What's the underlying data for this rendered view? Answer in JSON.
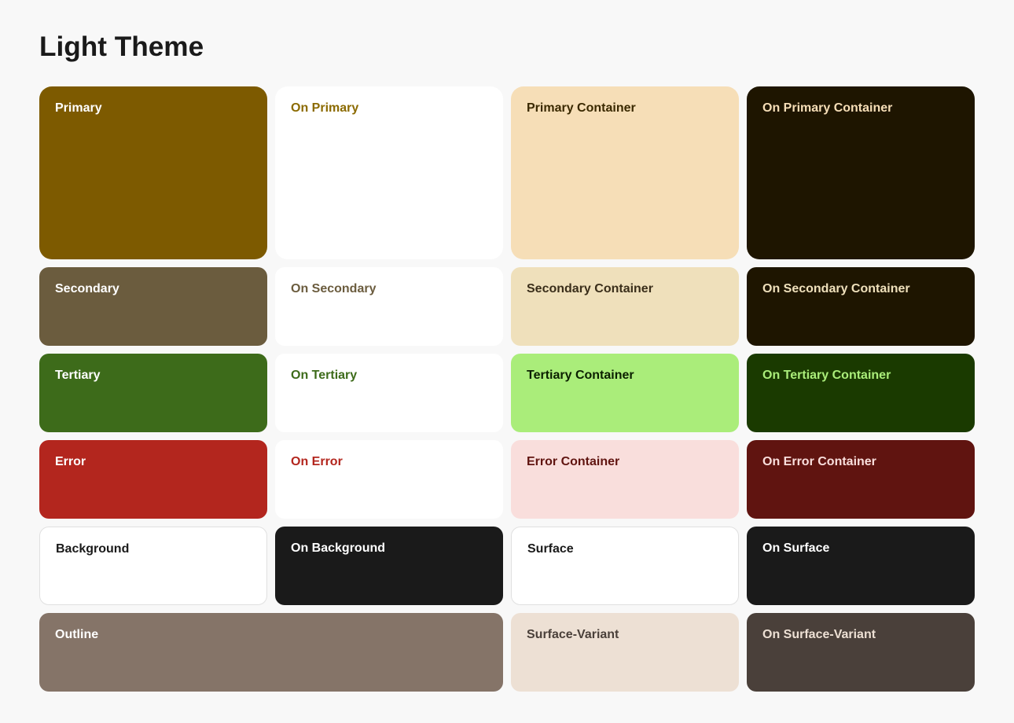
{
  "title": "Light Theme",
  "colors": {
    "primary": {
      "bg": "#7D5A00",
      "text": "#ffffff",
      "label": "Primary"
    },
    "on_primary": {
      "bg": "#ffffff",
      "text": "#8B6A00",
      "label": "On Primary"
    },
    "primary_container": {
      "bg": "#F6DEB7",
      "text": "#3A2900",
      "label": "Primary Container"
    },
    "on_primary_container": {
      "bg": "#1E1500",
      "text": "#F6DEB7",
      "label": "On Primary Container"
    },
    "secondary": {
      "bg": "#6B5C3E",
      "text": "#ffffff",
      "label": "Secondary"
    },
    "on_secondary": {
      "bg": "#ffffff",
      "text": "#6B5C3E",
      "label": "On Secondary"
    },
    "secondary_container": {
      "bg": "#EFE0BB",
      "text": "#3A2E1A",
      "label": "Secondary Container"
    },
    "on_secondary_container": {
      "bg": "#1E1500",
      "text": "#EFE0BB",
      "label": "On Secondary Container"
    },
    "tertiary": {
      "bg": "#3D6B1A",
      "text": "#ffffff",
      "label": "Tertiary"
    },
    "on_tertiary": {
      "bg": "#ffffff",
      "text": "#3D6B1A",
      "label": "On Tertiary"
    },
    "tertiary_container": {
      "bg": "#AAED7A",
      "text": "#0B2000",
      "label": "Tertiary Container"
    },
    "on_tertiary_container": {
      "bg": "#1A3A00",
      "text": "#AAED7A",
      "label": "On Tertiary Container"
    },
    "error": {
      "bg": "#B3261E",
      "text": "#ffffff",
      "label": "Error"
    },
    "on_error": {
      "bg": "#ffffff",
      "text": "#B3261E",
      "label": "On Error"
    },
    "error_container": {
      "bg": "#F9DEDC",
      "text": "#601410",
      "label": "Error Container"
    },
    "on_error_container": {
      "bg": "#601410",
      "text": "#F9DEDC",
      "label": "On Error Container"
    },
    "background": {
      "bg": "#ffffff",
      "text": "#1a1a1a",
      "label": "Background"
    },
    "on_background": {
      "bg": "#1a1a1a",
      "text": "#ffffff",
      "label": "On Background"
    },
    "surface": {
      "bg": "#ffffff",
      "text": "#1a1a1a",
      "label": "Surface"
    },
    "on_surface": {
      "bg": "#1a1a1a",
      "text": "#ffffff",
      "label": "On Surface"
    },
    "outline": {
      "bg": "#857468",
      "text": "#ffffff",
      "label": "Outline"
    },
    "surface_variant": {
      "bg": "#EDE0D4",
      "text": "#4A403A",
      "label": "Surface-Variant"
    },
    "on_surface_variant": {
      "bg": "#4A403A",
      "text": "#EDE0D4",
      "label": "On Surface-Variant"
    }
  }
}
